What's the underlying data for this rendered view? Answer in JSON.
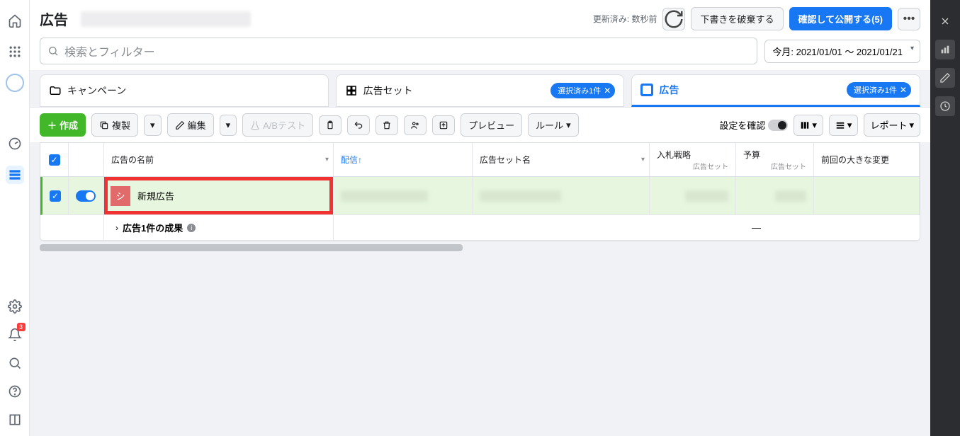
{
  "header": {
    "title": "広告",
    "status": "更新済み: 数秒前",
    "discard": "下書きを破棄する",
    "publish": "確認して公開する(5)"
  },
  "search": {
    "placeholder": "検索とフィルター",
    "date_range": "今月: 2021/01/01 ～ 2021/01/21"
  },
  "tabs": {
    "campaign": "キャンペーン",
    "adset": "広告セット",
    "adset_pill": "選択済み1件",
    "ad": "広告",
    "ad_pill": "選択済み1件"
  },
  "toolbar": {
    "create": "作成",
    "duplicate": "複製",
    "edit": "編集",
    "abtest": "A/Bテスト",
    "preview": "プレビュー",
    "rules": "ルール",
    "confirm_settings": "設定を確認",
    "report": "レポート"
  },
  "columns": {
    "name": "広告の名前",
    "delivery": "配信↑",
    "adset_name": "広告セット名",
    "bid": "入札戦略",
    "bid_sub": "広告セット",
    "budget": "予算",
    "budget_sub": "広告セット",
    "last_change": "前回の大きな変更"
  },
  "row": {
    "thumb_char": "シ",
    "ad_name": "新規広告"
  },
  "summary": {
    "label": "広告1件の成果",
    "dash": "—"
  }
}
